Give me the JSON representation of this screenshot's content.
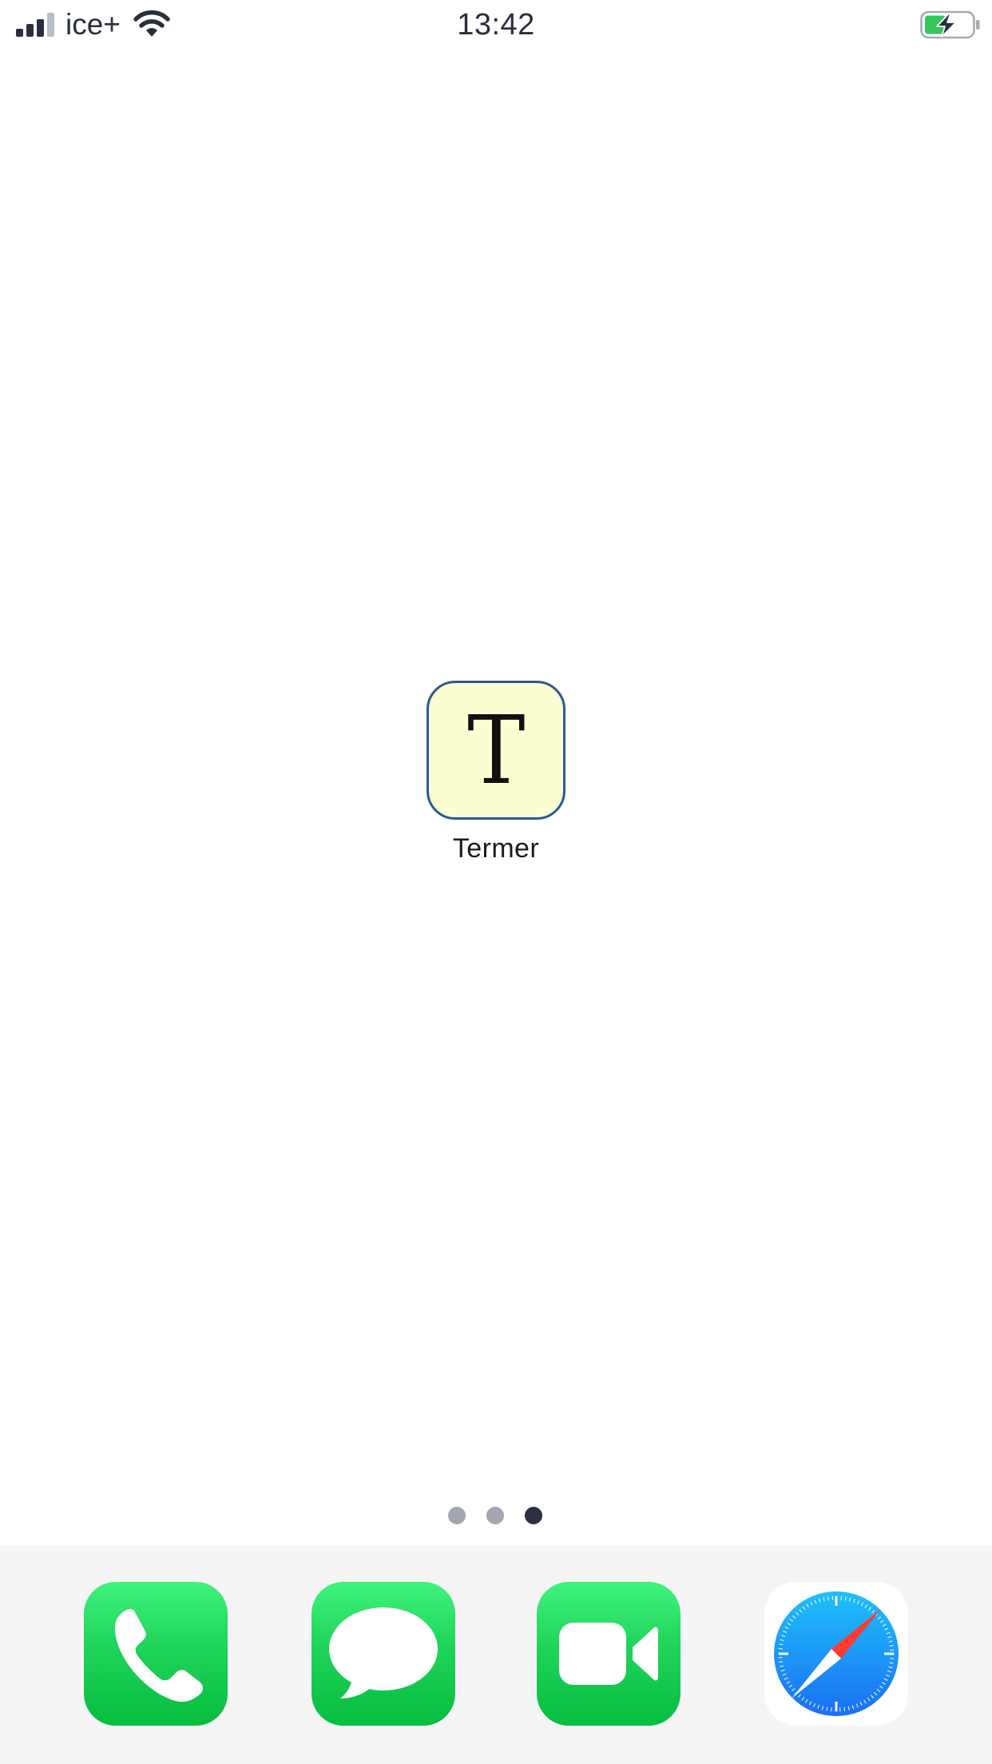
{
  "status_bar": {
    "carrier": "ice+",
    "time": "13:42",
    "signal_bars_active": 3,
    "signal_bars_total": 4,
    "battery_state": "charging",
    "icons": [
      "signal-icon",
      "wifi-icon",
      "battery-charging-icon"
    ]
  },
  "home_screen": {
    "app": {
      "label": "Termer",
      "glyph": "T",
      "icon": "termer-app-icon",
      "icon_background": "#fdfdd2",
      "icon_border": "#2d5a8f"
    },
    "pages": {
      "count": 3,
      "current": 3
    }
  },
  "dock": {
    "apps": [
      {
        "name": "phone",
        "icon": "phone-icon",
        "color": "#1fd45a"
      },
      {
        "name": "messages",
        "icon": "message-bubble-icon",
        "color": "#1fd45a"
      },
      {
        "name": "facetime",
        "icon": "video-camera-icon",
        "color": "#1fd45a"
      },
      {
        "name": "safari",
        "icon": "compass-icon",
        "color": "#1a7cf2"
      }
    ],
    "background": "#f5f5f5"
  }
}
